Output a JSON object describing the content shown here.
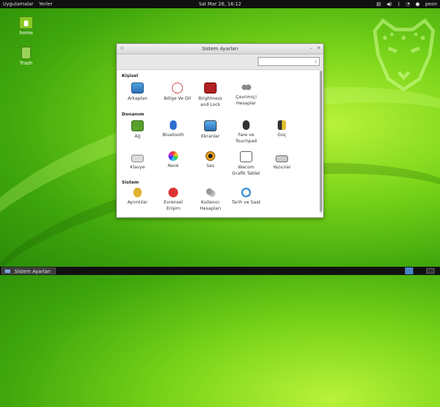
{
  "topbar": {
    "applications": "Uygulamalar",
    "places": "Yerler",
    "clock": "Sal Mar 26, 16:12",
    "user": "peon"
  },
  "desktop": {
    "home_label": "home",
    "trash_label": "Trash"
  },
  "window": {
    "title": "Sistem Ayarları",
    "search_placeholder": "",
    "sections": {
      "personal": "Kişisel",
      "hardware": "Donanım",
      "system": "Sistem"
    },
    "items": {
      "background": "Arkaplan",
      "region": "Bölge Ve Dil",
      "brightness1": "Brightness",
      "brightness2": "and Lock",
      "online1": "Çevrimiçi",
      "online2": "Hesaplar",
      "network": "Ağ",
      "bluetooth": "Bluetooth",
      "displays": "Ekranlar",
      "mouse1": "Fare ve",
      "mouse2": "Touchpad",
      "power": "Güç",
      "keyboard": "Klavye",
      "color": "Renk",
      "sound": "Ses",
      "wacom1": "Wacom",
      "wacom2": "Grafik Tablet",
      "printers": "Yazıcılar",
      "details": "Ayrıntılar",
      "universal1": "Evrensel",
      "universal2": "Erişim",
      "users1": "Kullanıcı",
      "users2": "Hesapları",
      "datetime": "Tarih ve Saat"
    }
  },
  "taskbar": {
    "task_label": "Sistem Ayarları"
  },
  "colors": {
    "accent": "#73ba25",
    "topbar": "#111111"
  }
}
